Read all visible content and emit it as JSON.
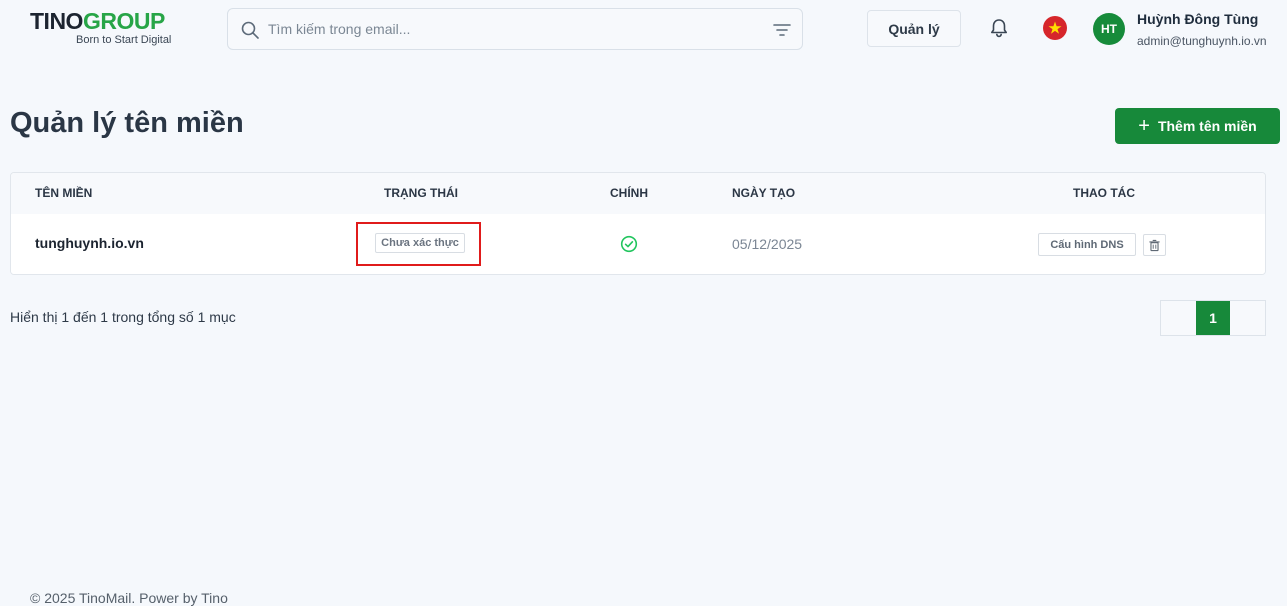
{
  "brand": {
    "name_part1": "TINO",
    "name_part2": "GROUP",
    "tagline": "Born to Start Digital",
    "accent_color": "#17893a"
  },
  "header": {
    "search_placeholder": "Tìm kiếm trong email...",
    "manage_label": "Quản lý",
    "user": {
      "initials": "HT",
      "name": "Huỳnh Đông Tùng",
      "email": "admin@tunghuynh.io.vn"
    },
    "icons": [
      "search-icon",
      "filter-icon",
      "bell-icon",
      "vietnam-flag-icon"
    ]
  },
  "page": {
    "title": "Quản lý tên miền",
    "add_button_label": "Thêm tên miền"
  },
  "table": {
    "columns": [
      "TÊN MIỀN",
      "TRẠNG THÁI",
      "CHÍNH",
      "NGÀY TẠO",
      "THAO TÁC"
    ],
    "rows": [
      {
        "domain": "tunghuynh.io.vn",
        "status": "Chưa xác thực",
        "primary": true,
        "created": "05/12/2025",
        "action_dns": "Cấu hình DNS"
      }
    ]
  },
  "pagination": {
    "summary": "Hiển thị 1 đến 1 trong tổng số 1 mục",
    "current_page": "1"
  },
  "footer": {
    "text": "© 2025 TinoMail. Power by Tino"
  }
}
